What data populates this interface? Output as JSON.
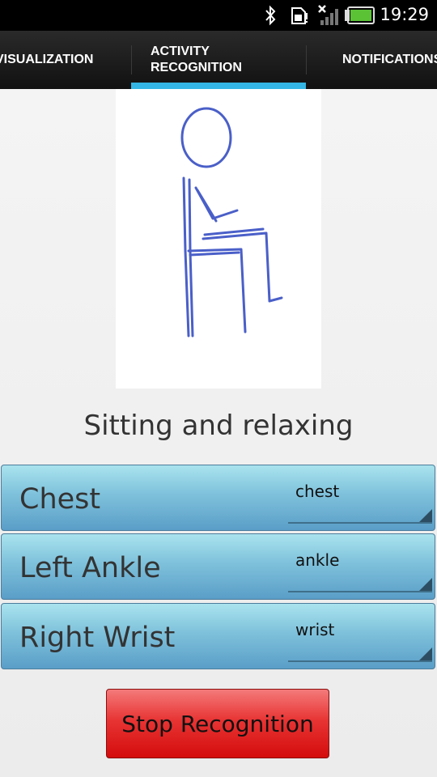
{
  "status_bar": {
    "time": "19:29",
    "icons": [
      "bluetooth-icon",
      "sd-card-icon",
      "signal-icon",
      "battery-icon"
    ]
  },
  "tabs": [
    {
      "label": "VISUALIZATION",
      "selected": false
    },
    {
      "label": "ACTIVITY RECOGNITION",
      "selected": true
    },
    {
      "label": "NOTIFICATIONS",
      "selected": false
    }
  ],
  "activity": {
    "image": "stick-figure-sitting",
    "label": "Sitting and relaxing"
  },
  "sensors": [
    {
      "name": "Chest",
      "selected": "chest"
    },
    {
      "name": "Left Ankle",
      "selected": "ankle"
    },
    {
      "name": "Right Wrist",
      "selected": "wrist"
    }
  ],
  "stop_button": {
    "label": "Stop Recognition"
  },
  "colors": {
    "tab_indicator": "#33b5e5",
    "row_top": "#a9e3ee",
    "row_bottom": "#5a9ec8",
    "button_red": "#e83434"
  }
}
